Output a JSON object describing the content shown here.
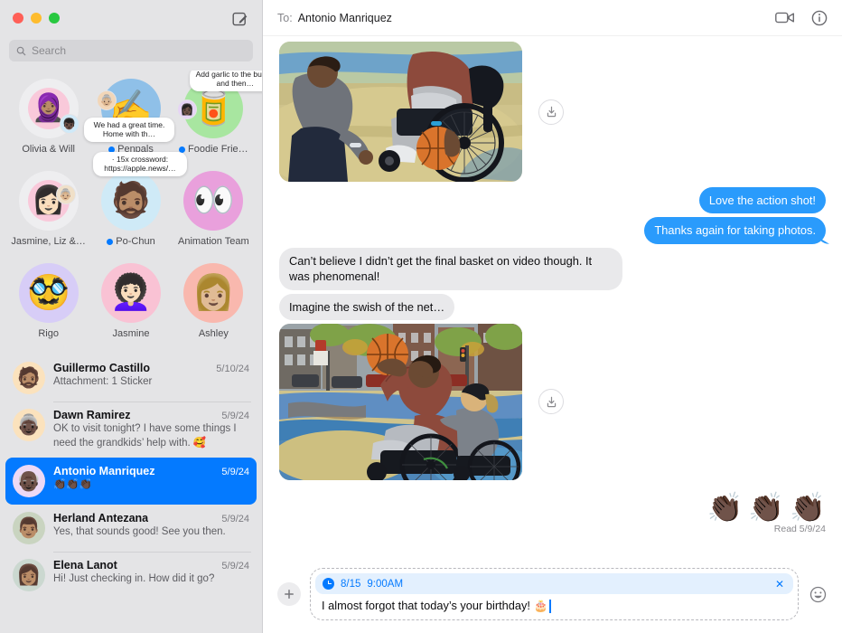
{
  "window": {
    "traffic_lights": [
      "close",
      "minimize",
      "zoom"
    ],
    "compose_icon": "compose-pencil-icon",
    "accent_color": "#047aff",
    "bubble_out_color": "#2a9bfc",
    "bubble_in_color": "#e9e9eb",
    "sidebar_bg": "#e4e4e6"
  },
  "sidebar": {
    "search": {
      "placeholder": "Search",
      "value": "",
      "icon": "search-icon"
    },
    "pinned": [
      {
        "name": "Olivia & Will",
        "unread": false,
        "avatar_emoji": "🧕🏽",
        "avatar_bg": "#eeeef0",
        "inner_bg": "#f9c9da",
        "mini_emoji": "👦🏿",
        "mini_bg": "#cfe9f8",
        "tapback": ""
      },
      {
        "name": "Penpals",
        "unread": true,
        "avatar_emoji": "✍️",
        "avatar_bg": "#8fc0e8",
        "inner_bg": "",
        "mini_emoji": "👵🏼",
        "mini_bg": "#f2d6b8",
        "tapback": "We had a great time. Home with th…"
      },
      {
        "name": "Foodie Frie…",
        "unread": true,
        "avatar_emoji": "🥫",
        "avatar_bg": "#a8e6a0",
        "inner_bg": "",
        "mini_emoji": "👩🏿",
        "mini_bg": "#e6d4f5",
        "tapback": "Add garlic to the butter, and then…"
      },
      {
        "name": "Jasmine, Liz &…",
        "unread": false,
        "avatar_emoji": "👩🏻",
        "avatar_bg": "#eeeef0",
        "inner_bg": "#f9c9da",
        "mini_emoji": "👵🏼",
        "mini_bg": "#f0e0c8",
        "tapback": ""
      },
      {
        "name": "Po-Chun",
        "unread": true,
        "avatar_emoji": "🧔🏽",
        "avatar_bg": "#cfeaf7",
        "inner_bg": "",
        "mini_emoji": "",
        "mini_bg": "",
        "tapback": "·   15x crossword: https://apple.news/…"
      },
      {
        "name": "Animation Team",
        "unread": false,
        "avatar_emoji": "👀",
        "avatar_bg": "#e9a0dc",
        "inner_bg": "",
        "mini_emoji": "",
        "mini_bg": "",
        "tapback": ""
      },
      {
        "name": "Rigo",
        "unread": false,
        "avatar_emoji": "🥸",
        "avatar_bg": "#d7cdf7",
        "inner_bg": "",
        "mini_emoji": "",
        "mini_bg": "",
        "tapback": ""
      },
      {
        "name": "Jasmine",
        "unread": false,
        "avatar_emoji": "👩🏻‍🦱",
        "avatar_bg": "#f9c2d4",
        "inner_bg": "",
        "mini_emoji": "",
        "mini_bg": "",
        "tapback": ""
      },
      {
        "name": "Ashley",
        "unread": false,
        "avatar_emoji": "👩🏼",
        "avatar_bg": "#f9b8ae",
        "inner_bg": "",
        "mini_emoji": "",
        "mini_bg": "",
        "tapback": ""
      }
    ],
    "conversations": [
      {
        "name": "Guillermo Castillo",
        "date": "5/10/24",
        "preview": "Attachment: 1 Sticker",
        "avatar_emoji": "🧔🏽",
        "avatar_bg": "#fbe2bd",
        "selected": false
      },
      {
        "name": "Dawn Ramirez",
        "date": "5/9/24",
        "preview": "OK to visit tonight? I have some things I need the grandkids’ help with. 🥰",
        "avatar_emoji": "👵🏿",
        "avatar_bg": "#fbe2bd",
        "selected": false
      },
      {
        "name": "Antonio Manriquez",
        "date": "5/9/24",
        "preview": "👏🏿👏🏿👏🏿",
        "avatar_emoji": "👴🏿",
        "avatar_bg": "#ecd9f5",
        "selected": true
      },
      {
        "name": "Herland Antezana",
        "date": "5/9/24",
        "preview": "Yes, that sounds good! See you then.",
        "avatar_emoji": "👨🏽",
        "avatar_bg": "#c9d4c0",
        "selected": false
      },
      {
        "name": "Elena Lanot",
        "date": "5/9/24",
        "preview": "Hi! Just checking in. How did it go?",
        "avatar_emoji": "👩🏽",
        "avatar_bg": "#cbd8d0",
        "selected": false
      }
    ]
  },
  "conversation": {
    "header": {
      "to_label": "To:",
      "recipient": "Antonio Manriquez",
      "facetime_icon": "video-camera-icon",
      "info_icon": "info-circle-icon"
    },
    "messages": [
      {
        "type": "photo",
        "side": "in",
        "alt": "Two people playing wheelchair basketball on an outdoor court",
        "download_icon": "download-icon"
      },
      {
        "type": "text",
        "side": "out",
        "text": "Love the action shot!"
      },
      {
        "type": "text",
        "side": "out",
        "text": "Thanks again for taking photos.",
        "tail": true
      },
      {
        "type": "text",
        "side": "in",
        "text": "Can’t believe I didn’t get the final basket on video though. It was phenomenal!"
      },
      {
        "type": "text",
        "side": "in",
        "text": "Imagine the swish of the net…"
      },
      {
        "type": "photo",
        "side": "in",
        "alt": "Man in wheelchair shooting a basketball on a painted city court",
        "download_icon": "download-icon"
      }
    ],
    "reactions": [
      "👏🏿",
      "👏🏿",
      "👏🏿"
    ],
    "read_receipt": "Read 5/9/24"
  },
  "compose": {
    "plus_icon": "plus-icon",
    "smart_chip": {
      "icon": "clock-icon",
      "date": "8/15",
      "time": "9:00AM",
      "dismiss_icon": "close-x-icon"
    },
    "message_text": "I almost forgot that today’s your birthday! 🎂",
    "emoji_icon": "smiley-face-icon"
  }
}
